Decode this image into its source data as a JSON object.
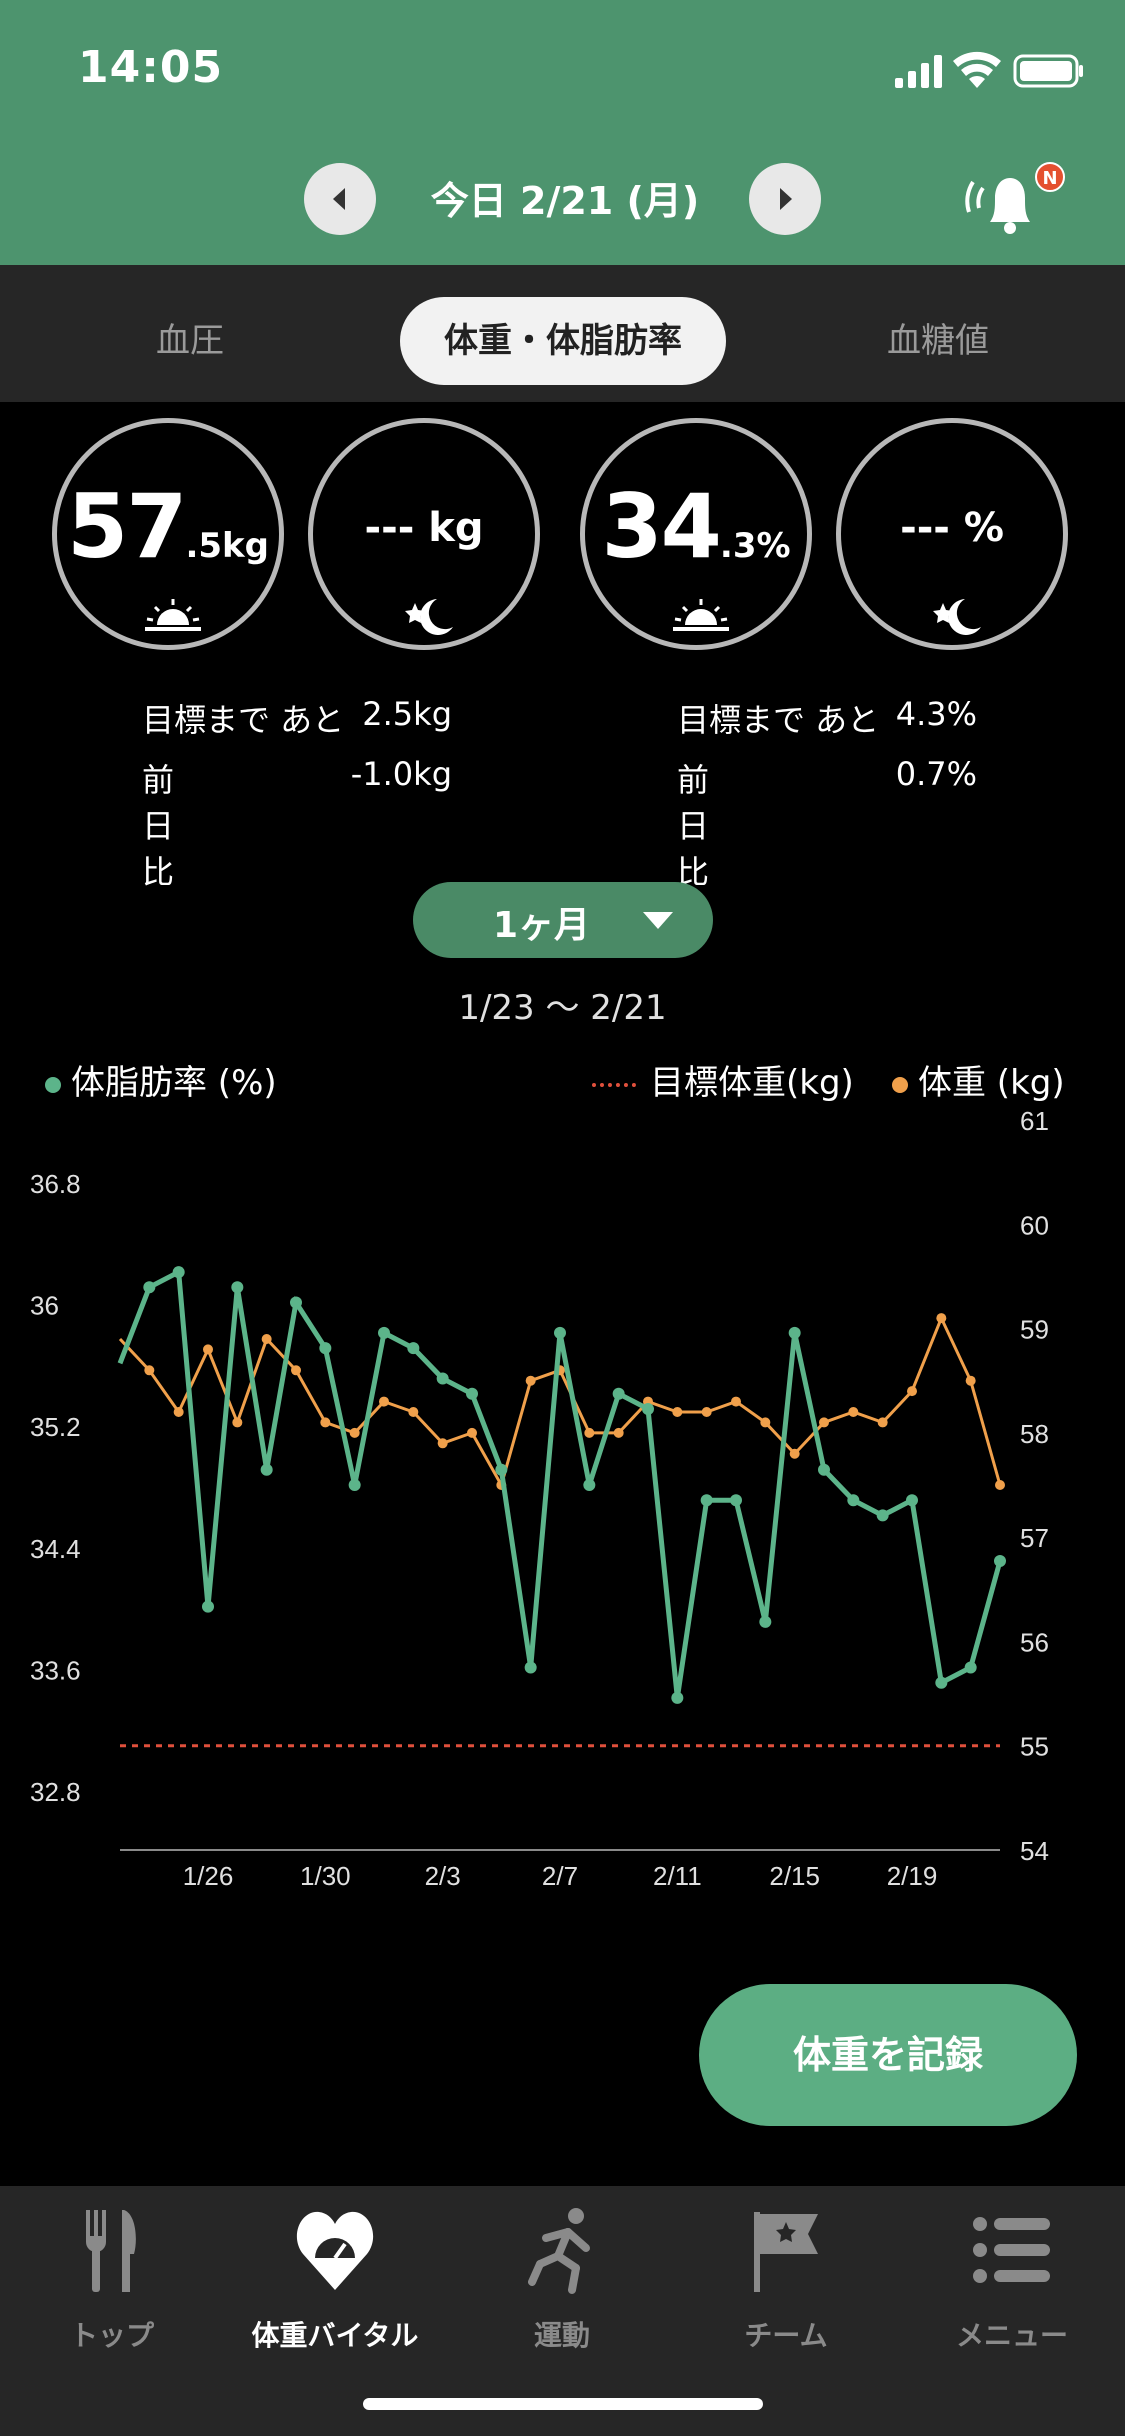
{
  "status": {
    "time": "14:05"
  },
  "header": {
    "date": "今日 2/21 (月)",
    "badge": "N"
  },
  "tabs": {
    "bp": "血圧",
    "weight": "体重・体脂肪率",
    "sugar": "血糖値"
  },
  "circles": {
    "weight_morning_int": "57",
    "weight_morning_dec": ".5kg",
    "weight_night": "--- kg",
    "fat_morning_int": "34",
    "fat_morning_dec": ".3%",
    "fat_night": "--- %"
  },
  "stats": {
    "target_label": "目標まで あと",
    "prev_label": "前日比",
    "weight_target": "2.5kg",
    "weight_prev": "-1.0kg",
    "fat_target": "4.3%",
    "fat_prev": "0.7%"
  },
  "period": {
    "label": "1ヶ月",
    "range": "1/23 ～ 2/21"
  },
  "legend": {
    "fat": "体脂肪率 (%)",
    "target": "目標体重(kg)",
    "weight": "体重 (kg)"
  },
  "colors": {
    "fat": "#5cb48a",
    "weight": "#f0a04b",
    "target": "#e0503c",
    "header": "#4d946e"
  },
  "chart_data": {
    "type": "line",
    "x_dates": [
      "1/23",
      "1/24",
      "1/25",
      "1/26",
      "1/27",
      "1/28",
      "1/29",
      "1/30",
      "1/31",
      "2/1",
      "2/2",
      "2/3",
      "2/4",
      "2/5",
      "2/6",
      "2/7",
      "2/8",
      "2/9",
      "2/10",
      "2/11",
      "2/12",
      "2/13",
      "2/14",
      "2/15",
      "2/16",
      "2/17",
      "2/18",
      "2/19",
      "2/20",
      "2/21"
    ],
    "x_tick_labels": [
      "1/26",
      "1/30",
      "2/3",
      "2/7",
      "2/11",
      "2/15",
      "2/19"
    ],
    "series": [
      {
        "name": "体脂肪率 (%)",
        "axis": "left",
        "values": [
          35.6,
          36.1,
          36.2,
          34.0,
          36.1,
          34.9,
          36.0,
          35.7,
          34.8,
          35.8,
          35.7,
          35.5,
          35.4,
          34.9,
          33.6,
          35.8,
          34.8,
          35.4,
          35.3,
          33.4,
          34.7,
          34.7,
          33.9,
          35.8,
          34.9,
          34.7,
          34.6,
          34.7,
          33.5,
          33.6,
          34.3
        ],
        "x_offset": 0
      },
      {
        "name": "体重 (kg)",
        "axis": "right",
        "values": [
          58.9,
          58.6,
          58.2,
          58.8,
          58.1,
          58.9,
          58.6,
          58.1,
          58.0,
          58.3,
          58.2,
          57.9,
          58.0,
          57.5,
          58.5,
          58.6,
          58.0,
          58.0,
          58.3,
          58.2,
          58.2,
          58.3,
          58.1,
          57.8,
          58.1,
          58.2,
          58.1,
          58.4,
          59.1,
          58.5,
          57.5
        ]
      },
      {
        "name": "目標体重(kg)",
        "axis": "right",
        "constant": 55.0
      }
    ],
    "y_left": {
      "ticks": [
        32.8,
        33.6,
        34.4,
        35.2,
        36,
        36.8
      ],
      "tick_labels": [
        "32.8",
        "33.6",
        "34.4",
        "35.2",
        "36",
        "36.8"
      ],
      "range": [
        32.4,
        37.2
      ]
    },
    "y_right": {
      "ticks": [
        54,
        55,
        56,
        57,
        58,
        59,
        60,
        61
      ],
      "tick_labels": [
        "54",
        "55",
        "56",
        "57",
        "58",
        "59",
        "60",
        "61"
      ],
      "range": [
        54,
        61
      ]
    }
  },
  "record_button": "体重を記録",
  "bottom_nav": [
    "トップ",
    "体重バイタル",
    "運動",
    "チーム",
    "メニュー"
  ]
}
